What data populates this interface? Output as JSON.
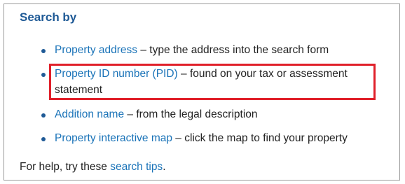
{
  "heading": "Search by",
  "items": [
    {
      "link": "Property address",
      "desc": " – type the address into the search form"
    },
    {
      "link": "Property ID number (PID)",
      "desc": " – found on your tax or assessment",
      "desc2": "statement"
    },
    {
      "link": "Addition name",
      "desc": " – from the legal description"
    },
    {
      "link": "Property interactive map",
      "desc": " – click the map to find your property"
    }
  ],
  "footer": {
    "prefix": "For help, try these ",
    "link": "search tips",
    "suffix": "."
  },
  "colors": {
    "heading": "#1f5a96",
    "link": "#1a73b8",
    "highlight": "#e0202a",
    "border": "#9a9a9a"
  }
}
